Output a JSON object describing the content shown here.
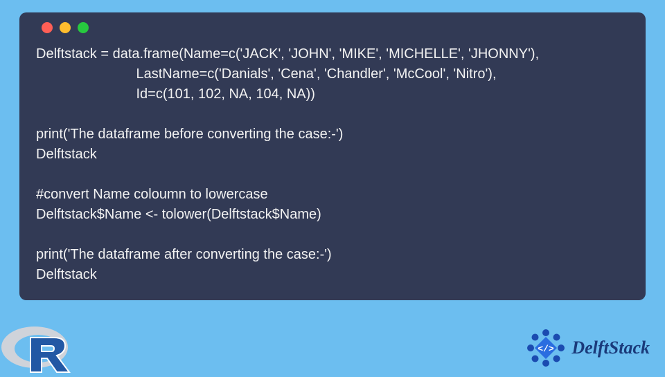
{
  "code": {
    "line1": "Delftstack = data.frame(Name=c('JACK', 'JOHN', 'MIKE', 'MICHELLE', 'JHONNY'),",
    "line2": "                          LastName=c('Danials', 'Cena', 'Chandler', 'McCool', 'Nitro'),",
    "line3": "                          Id=c(101, 102, NA, 104, NA))",
    "line4": "",
    "line5": "print('The dataframe before converting the case:-')",
    "line6": "Delftstack",
    "line7": "",
    "line8": "#convert Name coloumn to lowercase",
    "line9": "Delftstack$Name <- tolower(Delftstack$Name)",
    "line10": "",
    "line11": "print('The dataframe after converting the case:-')",
    "line12": "Delftstack"
  },
  "brand": {
    "name": "DelftStack"
  }
}
